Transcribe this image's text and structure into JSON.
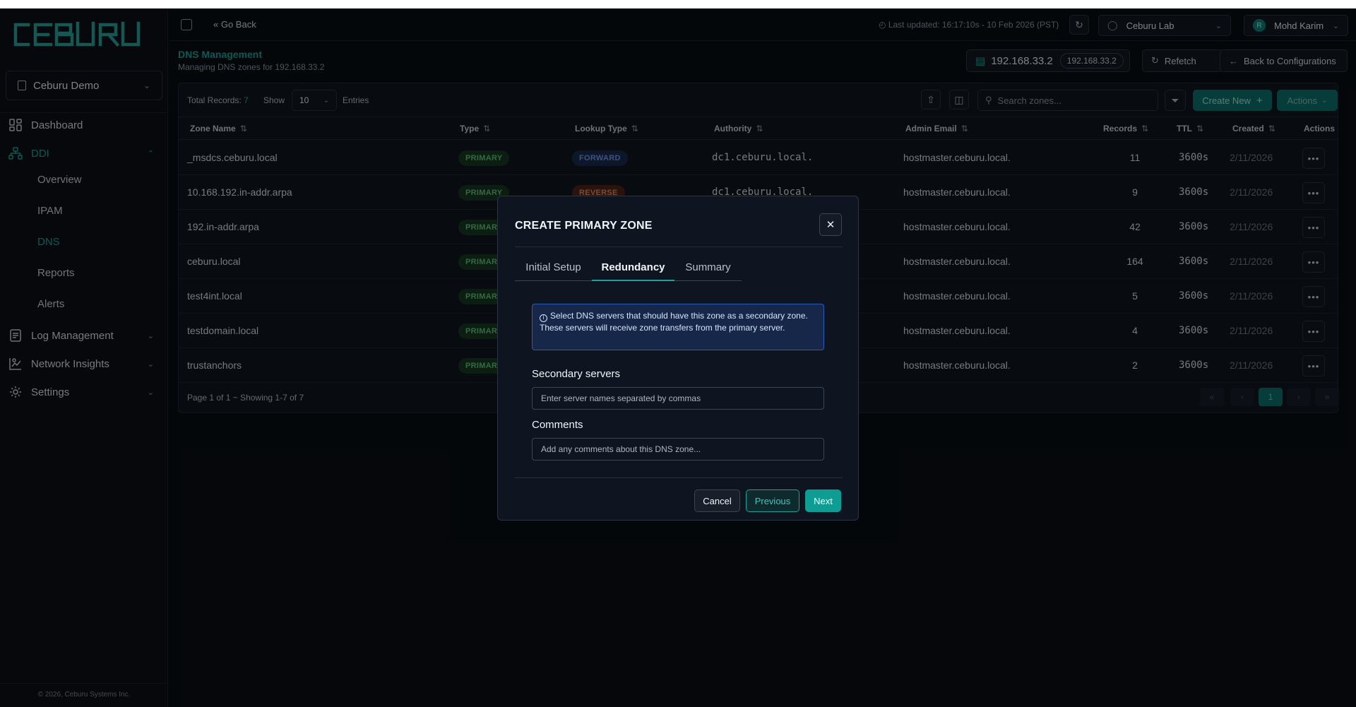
{
  "brand": {
    "logo_text": "CEBURU",
    "accent": "#19a39a"
  },
  "sidebar": {
    "org": "Ceburu Demo",
    "items": [
      {
        "label": "Dashboard",
        "icon": "dashboard-icon"
      },
      {
        "label": "DDI",
        "icon": "network-icon",
        "expanded": true
      },
      {
        "label": "Log Management",
        "icon": "log-icon"
      },
      {
        "label": "Network Insights",
        "icon": "insights-icon"
      },
      {
        "label": "Settings",
        "icon": "gear-icon"
      }
    ],
    "ddi_sub": [
      "Overview",
      "IPAM",
      "DNS",
      "Reports",
      "Alerts"
    ],
    "active_sub": "DNS",
    "copyright": "2026, Ceburu Systems Inc."
  },
  "topbar": {
    "go_back": "Go Back",
    "last_updated": "Last updated: 16:17:10s - 10 Feb 2026 (PST)",
    "lab": "Ceburu Lab",
    "user": "Mohd Karim",
    "user_initial": "R"
  },
  "header": {
    "title": "DNS Management",
    "subtitle": "Managing DNS zones for 192.168.33.2",
    "server_ip": "192.168.33.2",
    "server_pill": "192.168.33.2",
    "refetch": "Refetch",
    "back": "Back to Configurations"
  },
  "table": {
    "total_label": "Total Records:",
    "total": "7",
    "show": "Show",
    "show_value": "10",
    "entries": "Entries",
    "search_placeholder": "Search zones...",
    "create_new": "Create New",
    "actions": "Actions",
    "columns": [
      "Zone Name",
      "Type",
      "Lookup Type",
      "Authority",
      "Admin Email",
      "Records",
      "TTL",
      "Created",
      "Actions"
    ],
    "rows": [
      {
        "zone": "_msdcs.ceburu.local",
        "type": "PRIMARY",
        "lookup": "FORWARD",
        "authority": "dc1.ceburu.local.",
        "email": "hostmaster.ceburu.local.",
        "records": "11",
        "ttl": "3600s",
        "created": "2/11/2026"
      },
      {
        "zone": "10.168.192.in-addr.arpa",
        "type": "PRIMARY",
        "lookup": "REVERSE",
        "authority": "dc1.ceburu.local.",
        "email": "hostmaster.ceburu.local.",
        "records": "9",
        "ttl": "3600s",
        "created": "2/11/2026"
      },
      {
        "zone": "192.in-addr.arpa",
        "type": "PRIMARY",
        "lookup": "",
        "authority": "",
        "email": "hostmaster.ceburu.local.",
        "records": "42",
        "ttl": "3600s",
        "created": "2/11/2026"
      },
      {
        "zone": "ceburu.local",
        "type": "PRIMARY",
        "lookup": "",
        "authority": "",
        "email": "hostmaster.ceburu.local.",
        "records": "164",
        "ttl": "3600s",
        "created": "2/11/2026"
      },
      {
        "zone": "test4int.local",
        "type": "PRIMARY",
        "lookup": "",
        "authority": "",
        "email": "hostmaster.ceburu.local.",
        "records": "5",
        "ttl": "3600s",
        "created": "2/11/2026"
      },
      {
        "zone": "testdomain.local",
        "type": "PRIMARY",
        "lookup": "",
        "authority": "",
        "email": "hostmaster.ceburu.local.",
        "records": "4",
        "ttl": "3600s",
        "created": "2/11/2026"
      },
      {
        "zone": "trustanchors",
        "type": "PRIMARY",
        "lookup": "",
        "authority": "",
        "email": "hostmaster.ceburu.local.",
        "records": "2",
        "ttl": "3600s",
        "created": "2/11/2026"
      }
    ],
    "footer": "Page 1 of 1 ~ Showing 1-7 of 7",
    "page": "1"
  },
  "modal": {
    "title": "CREATE PRIMARY ZONE",
    "tabs": [
      "Initial Setup",
      "Redundancy",
      "Summary"
    ],
    "active_tab": "Redundancy",
    "info": "Select DNS servers that should have this zone as a secondary zone. These servers will receive zone transfers from the primary server.",
    "secondary_label": "Secondary servers",
    "secondary_placeholder": "Enter server names separated by commas",
    "secondary_value": "",
    "comments_label": "Comments",
    "comments_placeholder": "Add any comments about this DNS zone...",
    "comments_value": "",
    "cancel": "Cancel",
    "previous": "Previous",
    "next": "Next"
  }
}
